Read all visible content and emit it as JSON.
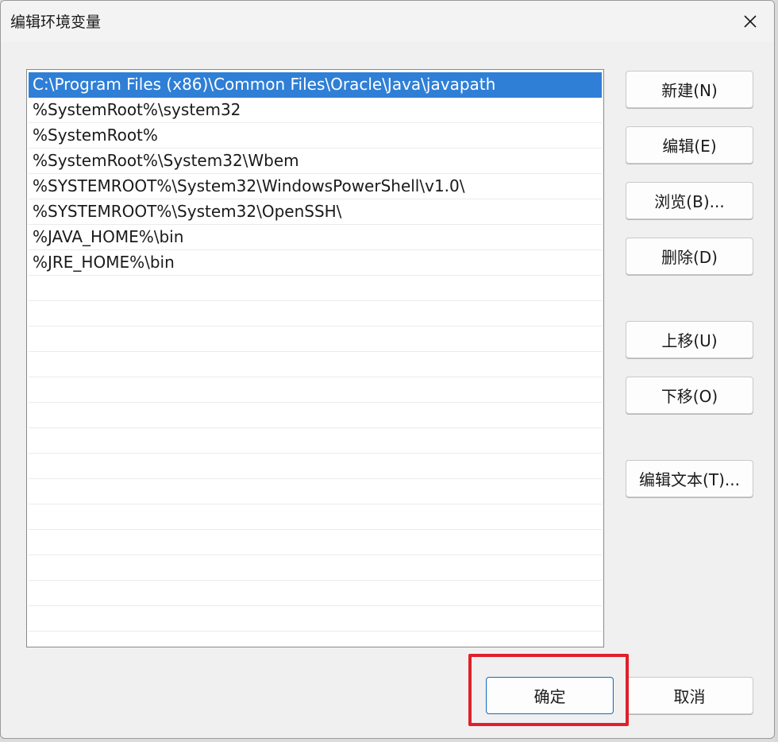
{
  "window": {
    "title": "编辑环境变量",
    "close_icon": "close-icon"
  },
  "path_list": {
    "items": [
      "C:\\Program Files (x86)\\Common Files\\Oracle\\Java\\javapath",
      "%SystemRoot%\\system32",
      "%SystemRoot%",
      "%SystemRoot%\\System32\\Wbem",
      "%SYSTEMROOT%\\System32\\WindowsPowerShell\\v1.0\\",
      "%SYSTEMROOT%\\System32\\OpenSSH\\",
      "%JAVA_HOME%\\bin",
      "%JRE_HOME%\\bin"
    ],
    "selected_index": 0
  },
  "buttons": {
    "new": "新建(N)",
    "edit": "编辑(E)",
    "browse": "浏览(B)...",
    "delete": "删除(D)",
    "move_up": "上移(U)",
    "move_down": "下移(O)",
    "edit_text": "编辑文本(T)...",
    "ok": "确定",
    "cancel": "取消"
  },
  "colors": {
    "selection": "#2f7fd6",
    "highlight": "#e0202b"
  }
}
